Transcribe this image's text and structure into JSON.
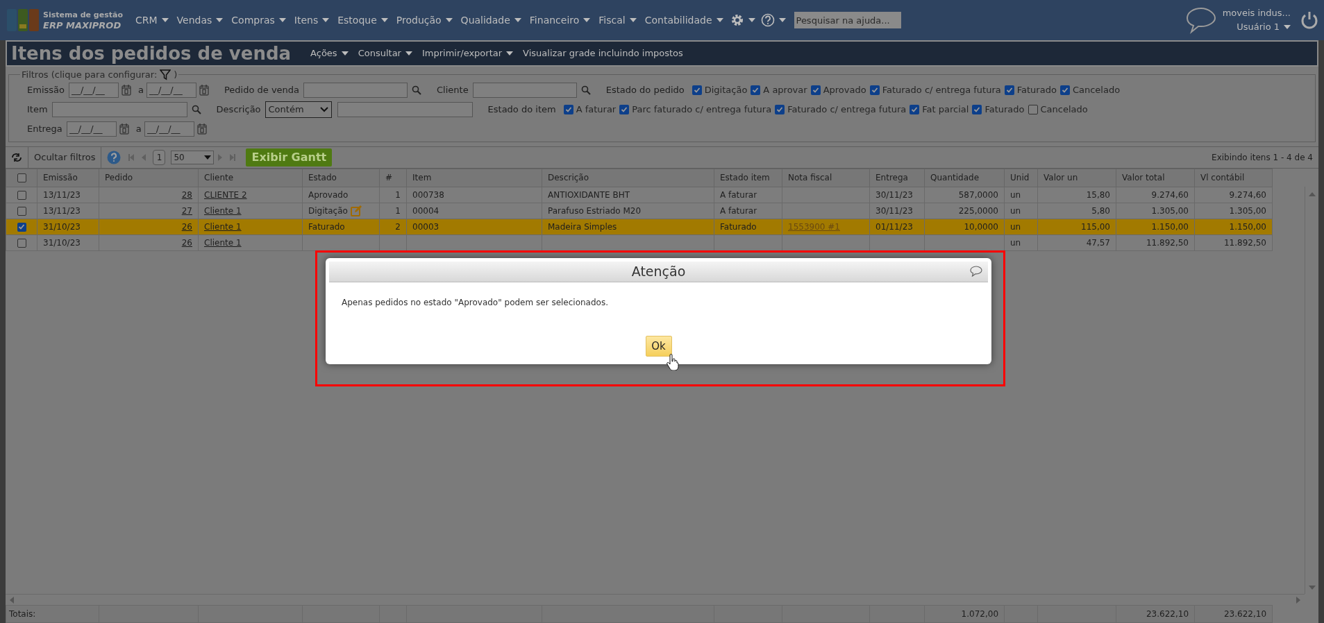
{
  "brand": {
    "line1": "Sistema de gestão",
    "line2": "ERP MAXIPROD"
  },
  "menu": [
    {
      "label": "CRM"
    },
    {
      "label": "Vendas"
    },
    {
      "label": "Compras"
    },
    {
      "label": "Itens"
    },
    {
      "label": "Estoque"
    },
    {
      "label": "Produção"
    },
    {
      "label": "Qualidade"
    },
    {
      "label": "Financeiro"
    },
    {
      "label": "Fiscal"
    },
    {
      "label": "Contabilidade"
    }
  ],
  "help_search": {
    "placeholder": "Pesquisar na ajuda..."
  },
  "user": {
    "company": "moveis indus...",
    "name": "Usuário 1"
  },
  "page_title": "Itens dos pedidos de venda",
  "actions": [
    {
      "label": "Ações",
      "has_menu": true
    },
    {
      "label": "Consultar",
      "has_menu": true
    },
    {
      "label": "Imprimir/exportar",
      "has_menu": true
    },
    {
      "label": "Visualizar grade incluindo impostos",
      "has_menu": false
    }
  ],
  "filters": {
    "legend_prefix": "Filtros (clique para configurar:",
    "legend_suffix": ")",
    "lines": [
      [
        {
          "kind": "date_range",
          "label": "Emissão",
          "placeholder": "__/__/__",
          "sep": "a",
          "placeholder_to": "__/__/__"
        },
        {
          "kind": "search_text",
          "label": "Pedido de venda"
        },
        {
          "kind": "search_text",
          "label": "Cliente"
        },
        {
          "kind": "checks",
          "label": "Estado do pedido",
          "options": [
            {
              "label": "Digitação",
              "checked": true
            },
            {
              "label": "A aprovar",
              "checked": true
            },
            {
              "label": "Aprovado",
              "checked": true
            },
            {
              "label": "Faturado c/ entrega futura",
              "checked": true
            },
            {
              "label": "Faturado",
              "checked": true
            },
            {
              "label": "Cancelado",
              "checked": true
            }
          ]
        }
      ],
      [
        {
          "kind": "search_text",
          "label": "Item"
        },
        {
          "kind": "select_text",
          "label": "Descrição",
          "value": "Contém"
        },
        {
          "kind": "checks",
          "label": "Estado do item",
          "options": [
            {
              "label": "A faturar",
              "checked": true
            },
            {
              "label": "Parc faturado c/ entrega futura",
              "checked": true
            },
            {
              "label": "Faturado c/ entrega futura",
              "checked": true
            },
            {
              "label": "Fat parcial",
              "checked": true
            },
            {
              "label": "Faturado",
              "checked": true
            },
            {
              "label": "Cancelado",
              "checked": false
            }
          ]
        }
      ],
      [
        {
          "kind": "date_range",
          "label": "Entrega",
          "placeholder": "__/__/__",
          "sep": "a",
          "placeholder_to": "__/__/__"
        }
      ]
    ]
  },
  "toolbar": {
    "hide_filters": "Ocultar filtros",
    "page": "1",
    "per_page": "50",
    "gantt": "Exibir Gantt",
    "summary": "Exibindo itens 1 - 4 de 4"
  },
  "table": {
    "header_checked": false,
    "columns": [
      {
        "label": "Emissão",
        "kind": "text"
      },
      {
        "label": "Pedido",
        "kind": "link_num"
      },
      {
        "label": "Cliente",
        "kind": "link"
      },
      {
        "label": "Estado",
        "kind": "text"
      },
      {
        "label": "#",
        "kind": "num"
      },
      {
        "label": "Item",
        "kind": "text"
      },
      {
        "label": "Descrição",
        "kind": "text"
      },
      {
        "label": "Estado item",
        "kind": "text"
      },
      {
        "label": "Nota fiscal",
        "kind": "link"
      },
      {
        "label": "Entrega",
        "kind": "text"
      },
      {
        "label": "Quantidade",
        "kind": "num",
        "total": "1.072,00"
      },
      {
        "label": "Unid",
        "kind": "text"
      },
      {
        "label": "Valor un",
        "kind": "num"
      },
      {
        "label": "Valor total",
        "kind": "num",
        "total": "23.622,10"
      },
      {
        "label": "Vl contábil",
        "kind": "num",
        "total": "23.622,10"
      }
    ],
    "rows": [
      {
        "selected": false,
        "checked": false,
        "editable": false,
        "cells": [
          "13/11/23",
          "28",
          "CLIENTE 2",
          "Aprovado",
          "1",
          "000738",
          "ANTIOXIDANTE BHT",
          "A faturar",
          null,
          "30/11/23",
          "587,0000",
          "un",
          "15,80",
          "9.274,60",
          "9.274,60"
        ]
      },
      {
        "selected": false,
        "checked": false,
        "editable": true,
        "cells": [
          "13/11/23",
          "27",
          "Cliente 1",
          "Digitação",
          "1",
          "00004",
          "Parafuso Estriado M20",
          "A faturar",
          null,
          "30/11/23",
          "225,0000",
          "un",
          "5,80",
          "1.305,00",
          "1.305,00"
        ]
      },
      {
        "selected": true,
        "checked": true,
        "editable": false,
        "cells": [
          "31/10/23",
          "26",
          "Cliente 1",
          "Faturado",
          "2",
          "00003",
          "Madeira Simples",
          "Faturado",
          "1553900 #1",
          "01/11/23",
          "10,0000",
          "un",
          "115,00",
          "1.150,00",
          "1.150,00"
        ]
      },
      {
        "selected": false,
        "checked": false,
        "editable": false,
        "cells": [
          "31/10/23",
          "26",
          "Cliente 1",
          null,
          null,
          null,
          null,
          null,
          null,
          null,
          null,
          "un",
          "47,57",
          "11.892,50",
          "11.892,50"
        ]
      }
    ],
    "totals_label": "Totais:"
  },
  "dialog": {
    "title": "Atenção",
    "message": "Apenas pedidos no estado \"Aprovado\" podem ser selecionados.",
    "button": "Ok"
  }
}
